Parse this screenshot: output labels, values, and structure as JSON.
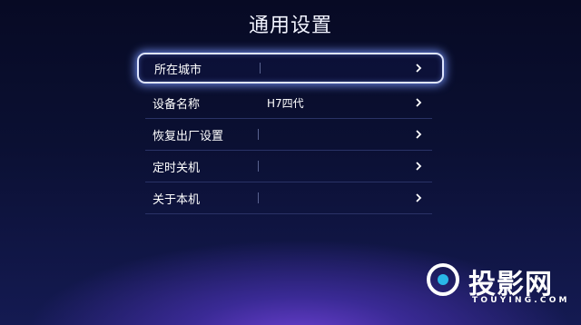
{
  "page": {
    "title": "通用设置"
  },
  "menu": {
    "items": [
      {
        "label": "所在城市",
        "value": "",
        "selected": true
      },
      {
        "label": "设备名称",
        "value": "H7四代",
        "selected": false
      },
      {
        "label": "恢复出厂设置",
        "value": "",
        "selected": false
      },
      {
        "label": "定时关机",
        "value": "",
        "selected": false
      },
      {
        "label": "关于本机",
        "value": "",
        "selected": false
      }
    ]
  },
  "icons": {
    "row_arrow": "chevron-right-icon",
    "logo": "touying-logo-icon"
  },
  "colors": {
    "focus_border": "#dfe6ff",
    "focus_glow": "#7896ff",
    "divider": "#2a3266",
    "logo_accent": "#29b7e8"
  },
  "watermark": {
    "brand": "投影网",
    "domain": "TOUYING.COM"
  }
}
